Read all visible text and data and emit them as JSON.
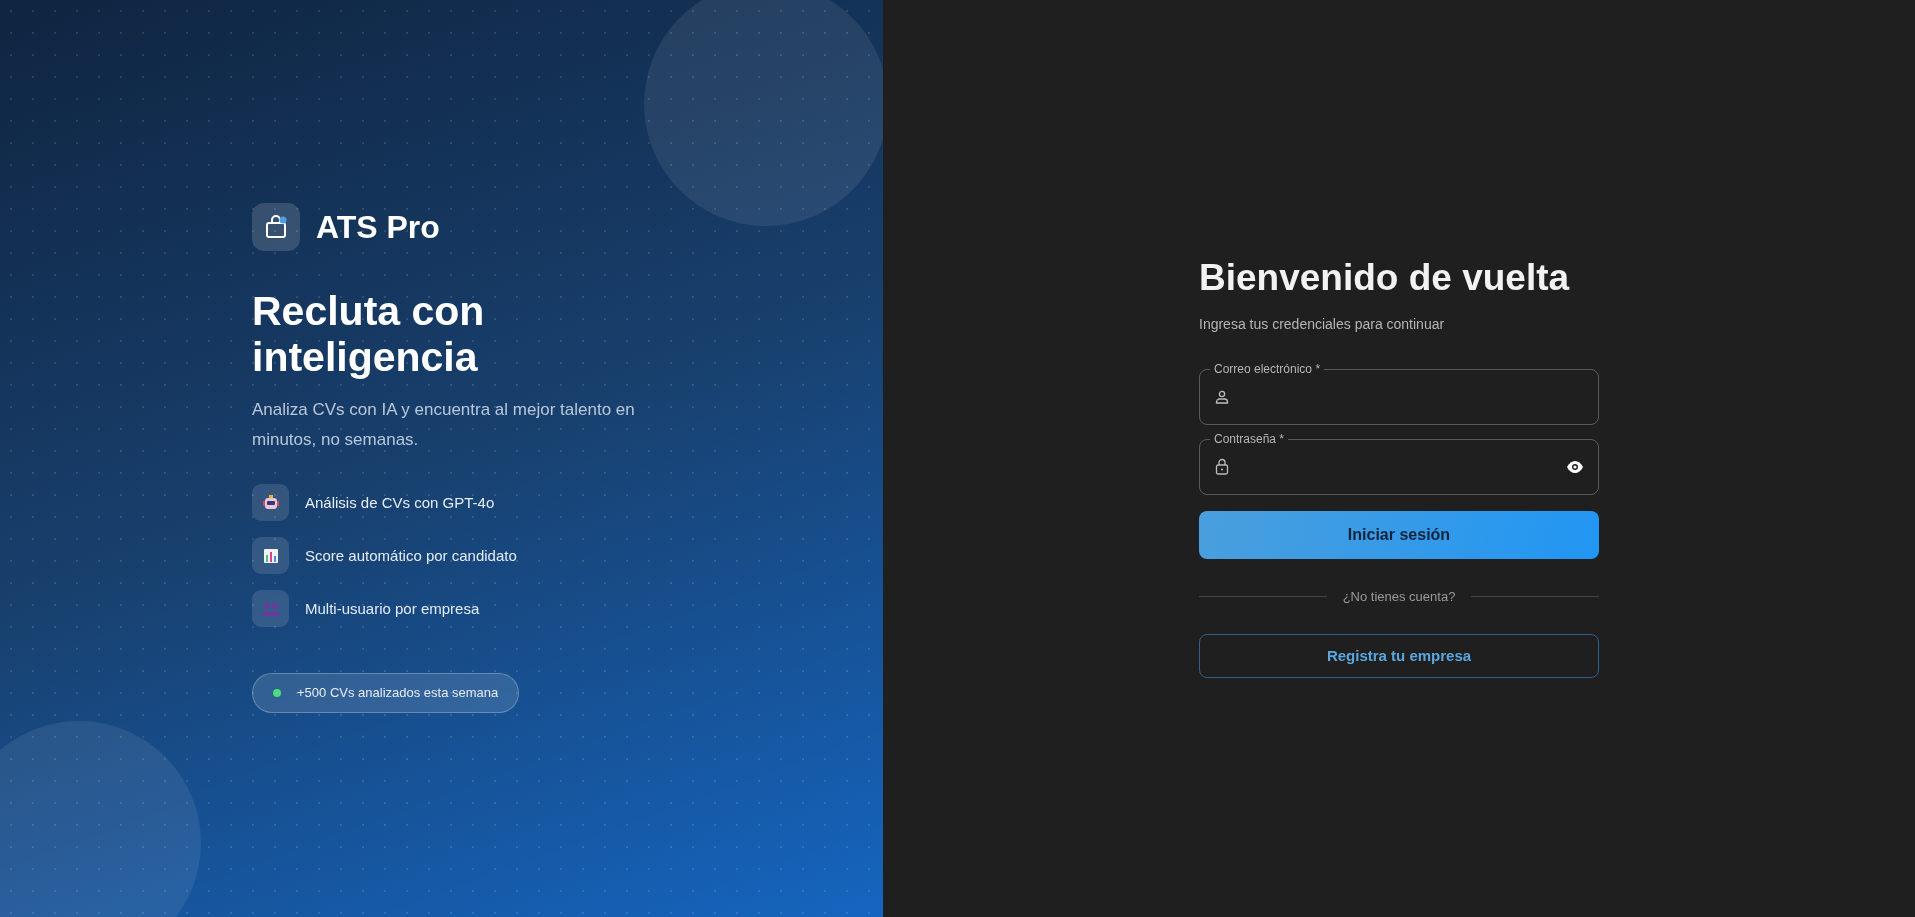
{
  "brand": {
    "name": "ATS Pro"
  },
  "hero": {
    "title": "Recluta con inteligencia",
    "subtitle": "Analiza CVs con IA y encuentra al mejor talento en minutos, no semanas."
  },
  "features": [
    {
      "kind": "robot",
      "label": "Análisis de CVs con GPT-4o"
    },
    {
      "kind": "chart",
      "label": "Score automático por candidato"
    },
    {
      "kind": "people",
      "label": "Multi-usuario por empresa"
    }
  ],
  "stat_badge": {
    "text": "+500 CVs analizados esta semana"
  },
  "login": {
    "title": "Bienvenido de vuelta",
    "subtitle": "Ingresa tus credenciales para continuar",
    "fields": [
      {
        "kind": "email",
        "label": "Correo electrónico *"
      },
      {
        "kind": "password",
        "label": "Contraseña *"
      }
    ],
    "submit": "Iniciar sesión",
    "divider": "¿No tienes cuenta?",
    "register": "Registra tu empresa"
  }
}
